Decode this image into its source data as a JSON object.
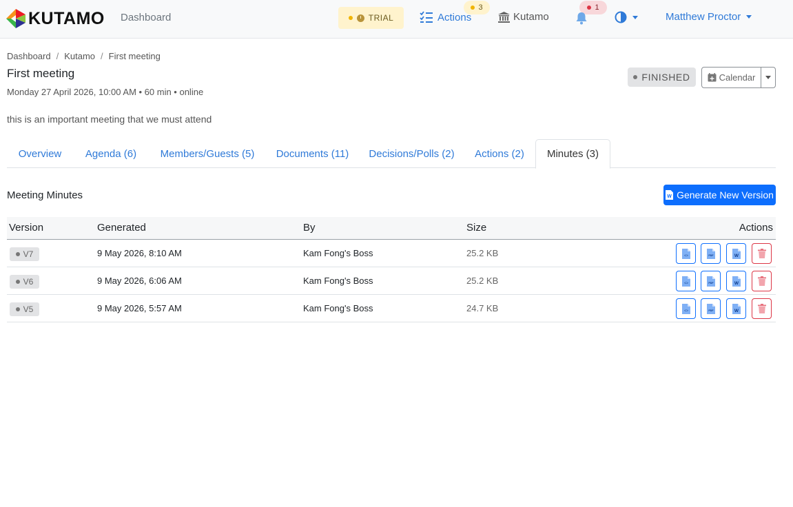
{
  "navbar": {
    "brand": "KUTAMO",
    "dashboard_link": "Dashboard",
    "trial_label": "TRIAL",
    "actions_label": "Actions",
    "actions_count": "3",
    "org_label": "Kutamo",
    "notifications_count": "1",
    "user_name": "Matthew Proctor"
  },
  "breadcrumb": {
    "items": [
      "Dashboard",
      "Kutamo",
      "First meeting"
    ],
    "separator": "/"
  },
  "meeting": {
    "title": "First meeting",
    "meta": "Monday 27 April 2026, 10:00 AM • 60 min • online",
    "description": "this is an important meeting that we must attend",
    "status": "FINISHED",
    "calendar_label": "Calendar"
  },
  "tabs": [
    {
      "label": "Overview",
      "active": false
    },
    {
      "label": "Agenda (6)",
      "active": false
    },
    {
      "label": "Members/Guests (5)",
      "active": false
    },
    {
      "label": "Documents (11)",
      "active": false
    },
    {
      "label": "Decisions/Polls (2)",
      "active": false
    },
    {
      "label": "Actions (2)",
      "active": false
    },
    {
      "label": "Minutes (3)",
      "active": true
    }
  ],
  "minutes": {
    "section_title": "Meeting Minutes",
    "generate_label": "Generate New Version",
    "columns": {
      "version": "Version",
      "generated": "Generated",
      "by": "By",
      "size": "Size",
      "actions": "Actions"
    },
    "rows": [
      {
        "version": "V7",
        "generated": "9 May 2026, 8:10 AM",
        "by": "Kam Fong's Boss",
        "size": "25.2 KB"
      },
      {
        "version": "V6",
        "generated": "9 May 2026, 6:06 AM",
        "by": "Kam Fong's Boss",
        "size": "25.2 KB"
      },
      {
        "version": "V5",
        "generated": "9 May 2026, 5:57 AM",
        "by": "Kam Fong's Boss",
        "size": "24.7 KB"
      }
    ],
    "row_actions": [
      "html-icon",
      "pdf-icon",
      "word-icon",
      "trash-icon"
    ]
  },
  "colors": {
    "primary": "#0d6efd",
    "link": "#2f7ad8",
    "danger": "#dc3545",
    "warning_bg": "#fff3cd",
    "navbar_bg": "#f8f9fa"
  }
}
